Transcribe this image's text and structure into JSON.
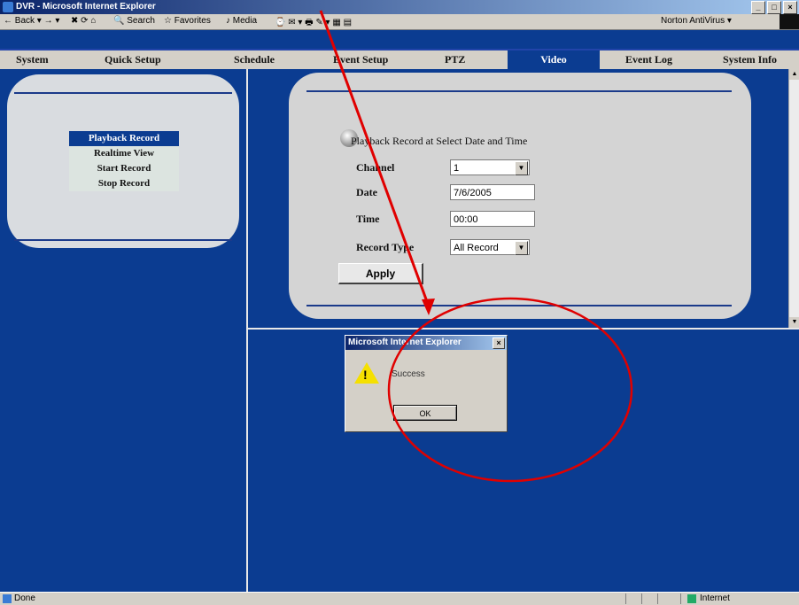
{
  "window": {
    "title": "DVR - Microsoft Internet Explorer",
    "buttons": [
      "_",
      "□",
      "×"
    ]
  },
  "toolbar": {
    "back": "Back",
    "search": "Search",
    "favorites": "Favorites",
    "media": "Media",
    "norton": "Norton AntiVirus"
  },
  "nav": {
    "items": [
      "System",
      "Quick Setup",
      "Schedule",
      "Event Setup",
      "PTZ",
      "Video",
      "Event Log",
      "System Info"
    ],
    "active": "Video"
  },
  "sidebar": {
    "items": [
      "Playback Record",
      "Realtime View",
      "Start Record",
      "Stop Record"
    ],
    "selected": "Playback Record"
  },
  "form": {
    "heading": "Playback Record at Select Date and Time",
    "channel_label": "Channel",
    "channel_value": "1",
    "date_label": "Date",
    "date_value": "7/6/2005",
    "time_label": "Time",
    "time_value": "00:00",
    "record_type_label": "Record Type",
    "record_type_value": "All Record",
    "apply_label": "Apply"
  },
  "dialog": {
    "title": "Microsoft Internet Explorer",
    "close": "×",
    "message": "Success",
    "ok_label": "OK"
  },
  "status": {
    "left": "Done",
    "zone": "Internet"
  },
  "colors": {
    "page_bg": "#0b3c91",
    "annotation": "#e00000"
  }
}
